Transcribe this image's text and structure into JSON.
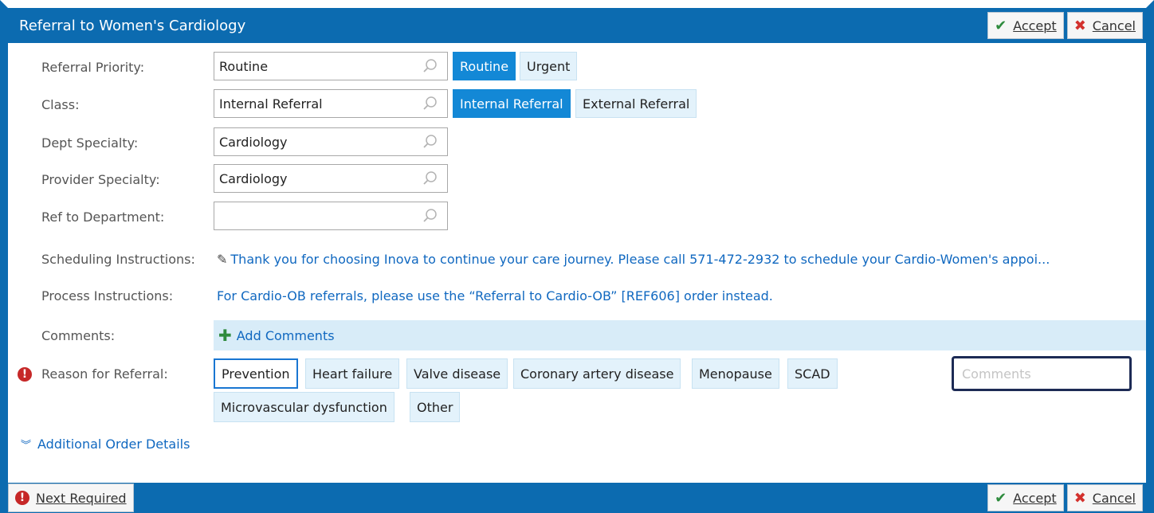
{
  "window": {
    "title": "Referral to Women's Cardiology"
  },
  "actions": {
    "accept": "Accept",
    "cancel": "Cancel"
  },
  "form": {
    "priority": {
      "label": "Referral Priority:",
      "value": "Routine",
      "options": [
        "Routine",
        "Urgent"
      ]
    },
    "class": {
      "label": "Class:",
      "value": "Internal Referral",
      "options": [
        "Internal Referral",
        "External Referral"
      ]
    },
    "dept_specialty": {
      "label": "Dept Specialty:",
      "value": "Cardiology"
    },
    "provider_specialty": {
      "label": "Provider Specialty:",
      "value": "Cardiology"
    },
    "ref_department": {
      "label": "Ref to Department:",
      "value": ""
    },
    "scheduling": {
      "label": "Scheduling Instructions:",
      "text": "Thank you for choosing Inova to continue your care journey. Please call 571-472-2932 to schedule your Cardio-Women's appoi..."
    },
    "process": {
      "label": "Process Instructions:",
      "text": "For Cardio-OB referrals, please use the “Referral to Cardio-OB” [REF606] order instead."
    },
    "comments": {
      "label": "Comments:",
      "add_label": "Add Comments"
    },
    "reason": {
      "label": "Reason for Referral:",
      "options": [
        "Prevention",
        "Heart failure",
        "Valve disease",
        "Coronary artery disease",
        "Menopause",
        "SCAD",
        "Microvascular dysfunction",
        "Other"
      ],
      "comments_placeholder": "Comments"
    },
    "additional_details": "Additional Order Details"
  },
  "footer": {
    "next_required": "Next Required"
  },
  "colors": {
    "primary": "#0c6bb0",
    "selected": "#1388d6",
    "link": "#1068c0",
    "required": "#c62828"
  }
}
